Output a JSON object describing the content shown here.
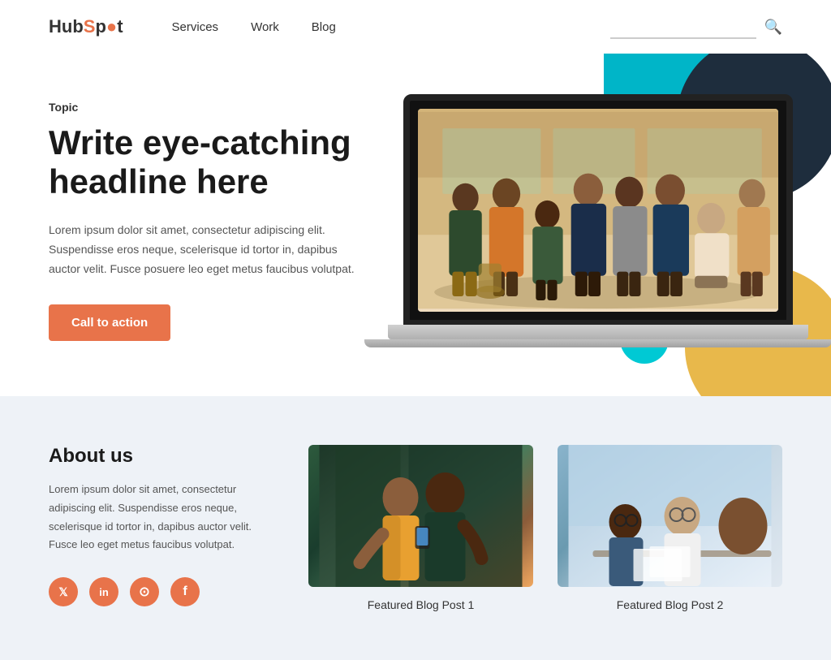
{
  "header": {
    "logo_text": "HubSpot",
    "logo_dot": "●",
    "nav": [
      {
        "label": "Services",
        "href": "#"
      },
      {
        "label": "Work",
        "href": "#"
      },
      {
        "label": "Blog",
        "href": "#"
      }
    ],
    "search_placeholder": "",
    "search_icon": "🔍"
  },
  "hero": {
    "topic": "Topic",
    "headline": "Write eye-catching headline here",
    "body": "Lorem ipsum dolor sit amet, consectetur adipiscing elit. Suspendisse eros neque, scelerisque id tortor in, dapibus auctor velit. Fusce posuere leo eget metus faucibus volutpat.",
    "cta_label": "Call to action"
  },
  "about": {
    "title": "About us",
    "body": "Lorem ipsum dolor sit amet, consectetur adipiscing elit. Suspendisse eros neque, scelerisque id tortor in, dapibus auctor velit. Fusce leo eget metus faucibus volutpat.",
    "social_icons": [
      {
        "name": "twitter",
        "symbol": "🐦"
      },
      {
        "name": "linkedin",
        "symbol": "in"
      },
      {
        "name": "instagram",
        "symbol": "📷"
      },
      {
        "name": "facebook",
        "symbol": "f"
      }
    ],
    "posts": [
      {
        "caption": "Featured Blog Post 1"
      },
      {
        "caption": "Featured Blog Post 2"
      }
    ]
  }
}
